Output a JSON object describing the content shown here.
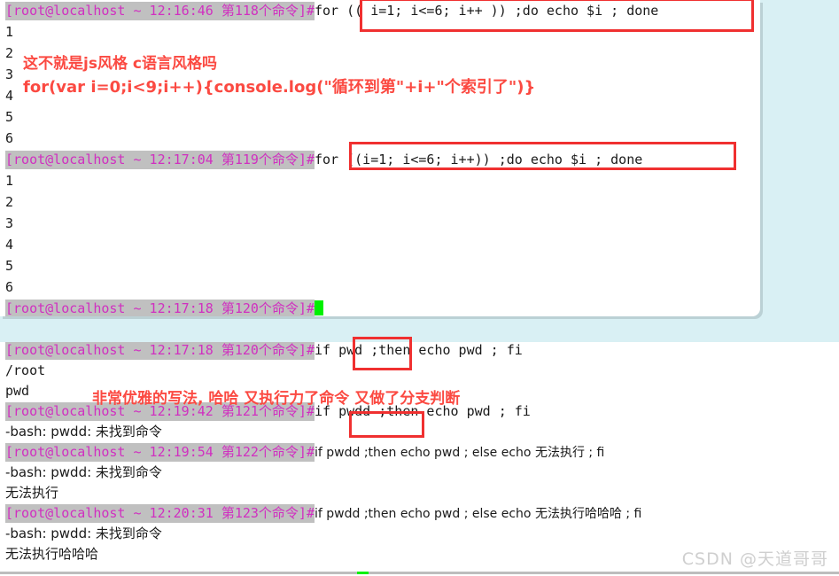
{
  "page": {
    "background_color": "#d9f0f4",
    "panel_background": "#ffffff",
    "prompt_highlight_color": "#c0c0c0",
    "prompt_text_color": "#d030c0",
    "annotation_color": "#fb4a42",
    "cursor_color": "#00f000"
  },
  "watermark": {
    "text": "CSDN @天道哥哥"
  },
  "top_panel": {
    "lines": [
      {
        "type": "prompt",
        "prompt": "[root@localhost ~ 12:16:46 第118个命令]",
        "hash": "#",
        "command": "for (( i=1; i<=6; i++ )) ;do echo $i ; done"
      },
      {
        "type": "output",
        "text": "1"
      },
      {
        "type": "output",
        "text": "2"
      },
      {
        "type": "output",
        "text": "3"
      },
      {
        "type": "output",
        "text": "4"
      },
      {
        "type": "output",
        "text": "5"
      },
      {
        "type": "output",
        "text": "6"
      },
      {
        "type": "prompt",
        "prompt": "[root@localhost ~ 12:17:04 第119个命令]",
        "hash": "#",
        "command": "for ((i=1; i<=6; i++)) ;do echo $i ; done"
      },
      {
        "type": "output",
        "text": "1"
      },
      {
        "type": "output",
        "text": "2"
      },
      {
        "type": "output",
        "text": "3"
      },
      {
        "type": "output",
        "text": "4"
      },
      {
        "type": "output",
        "text": "5"
      },
      {
        "type": "output",
        "text": "6"
      },
      {
        "type": "prompt",
        "prompt": "[root@localhost ~ 12:17:18 第120个命令]",
        "hash": "#",
        "command": "",
        "cursor": true
      }
    ],
    "annotations": [
      {
        "name": "js-style-note",
        "text": "这不就是js风格 c语言风格吗"
      },
      {
        "name": "js-for-loop-example",
        "text": "for(var i=0;i<9;i++){console.log(\"循环到第\"+i+\"个索引了\")}"
      }
    ],
    "boxes": [
      {
        "name": "highlight-box-cstyle-for",
        "target": "for (( i=1; i<=6; i++ )) ;do echo $i ; done"
      },
      {
        "name": "highlight-box-compact-for",
        "target": "for ((i=1; i<=6; i++)) ;do echo $i ; done"
      }
    ]
  },
  "bottom_panel": {
    "lines": [
      {
        "type": "prompt",
        "prompt": "[root@localhost ~ 12:17:18 第120个命令]",
        "hash": "#",
        "command": "if pwd ;then echo pwd ; fi"
      },
      {
        "type": "output",
        "text": "/root"
      },
      {
        "type": "output",
        "text": "pwd"
      },
      {
        "type": "prompt",
        "prompt": "[root@localhost ~ 12:19:42 第121个命令]",
        "hash": "#",
        "command": "if pwdd ;then echo pwd ; fi"
      },
      {
        "type": "output",
        "text": "-bash: pwdd: 未找到命令"
      },
      {
        "type": "prompt",
        "prompt": "[root@localhost ~ 12:19:54 第122个命令]",
        "hash": "#",
        "command": "if pwdd ;then echo pwd ; else echo 无法执行 ; fi"
      },
      {
        "type": "output",
        "text": "-bash: pwdd: 未找到命令"
      },
      {
        "type": "output",
        "text": "无法执行"
      },
      {
        "type": "prompt",
        "prompt": "[root@localhost ~ 12:20:31 第123个命令]",
        "hash": "#",
        "command": "if pwdd ;then echo pwd ; else echo 无法执行哈哈哈 ; fi"
      },
      {
        "type": "output",
        "text": "-bash: pwdd: 未找到命令"
      },
      {
        "type": "output",
        "text": "无法执行哈哈哈"
      }
    ],
    "annotations": [
      {
        "name": "elegant-style-note",
        "text": "非常优雅的写法, 哈哈 又执行力了命令 又做了分支判断"
      }
    ],
    "boxes": [
      {
        "name": "highlight-box-if-pwd",
        "target": "if pwd"
      },
      {
        "name": "highlight-box-if-pwdd",
        "target": "if pwdd"
      }
    ]
  }
}
